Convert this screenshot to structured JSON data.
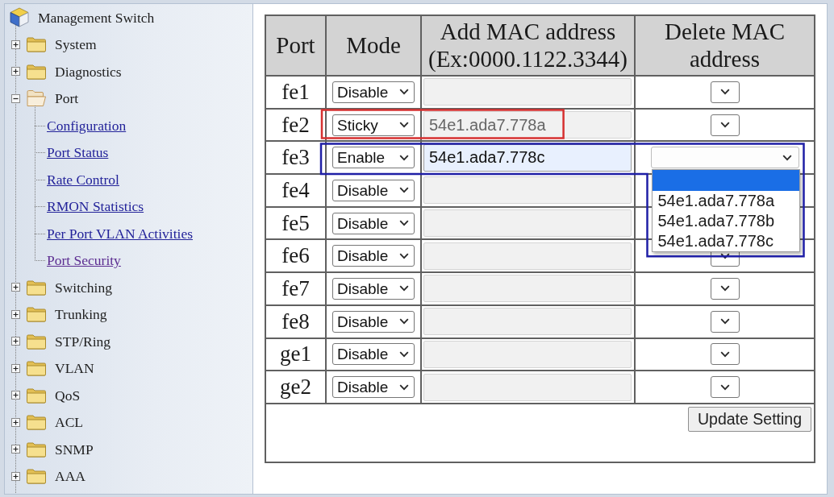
{
  "sidebar": {
    "title": "Management Switch",
    "items": [
      {
        "label": "System",
        "expanded": false
      },
      {
        "label": "Diagnostics",
        "expanded": false
      },
      {
        "label": "Port",
        "expanded": true,
        "children": [
          {
            "label": "Configuration",
            "visited": false
          },
          {
            "label": "Port Status",
            "visited": false
          },
          {
            "label": "Rate Control",
            "visited": false
          },
          {
            "label": "RMON Statistics",
            "visited": false
          },
          {
            "label": "Per Port VLAN Activities",
            "visited": false
          },
          {
            "label": "Port Security",
            "visited": true
          }
        ]
      },
      {
        "label": "Switching",
        "expanded": false
      },
      {
        "label": "Trunking",
        "expanded": false
      },
      {
        "label": "STP/Ring",
        "expanded": false
      },
      {
        "label": "VLAN",
        "expanded": false
      },
      {
        "label": "QoS",
        "expanded": false
      },
      {
        "label": "ACL",
        "expanded": false
      },
      {
        "label": "SNMP",
        "expanded": false
      },
      {
        "label": "AAA",
        "expanded": false
      }
    ]
  },
  "table": {
    "columns": [
      "Port",
      "Mode",
      "Add MAC address (Ex:0000.1122.3344)",
      "Delete MAC address"
    ],
    "rows": [
      {
        "port": "fe1",
        "mode": "Disable",
        "mac": {
          "disabled": true
        },
        "delete_mac": {
          "expanded": false
        }
      },
      {
        "port": "fe2",
        "mode": "Sticky",
        "mac": {
          "value": "54e1.ada7.778a",
          "disabled": true
        },
        "delete_mac": {
          "expanded": false
        },
        "outline": {
          "color": "#d63030",
          "kind": "fields"
        }
      },
      {
        "port": "fe3",
        "mode": "Enable",
        "mac": {
          "value": "54e1.ada7.778c",
          "disabled": false
        },
        "delete_mac": {
          "expanded": true,
          "options": [
            {
              "selected": true
            },
            {
              "label": "54e1.ada7.778a",
              "selected": false
            },
            {
              "label": "54e1.ada7.778b",
              "selected": false
            },
            {
              "label": "54e1.ada7.778c",
              "selected": false
            }
          ]
        },
        "outline": {
          "color": "#1f1fa6",
          "kind": "row"
        }
      },
      {
        "port": "fe4",
        "mode": "Disable",
        "mac": {
          "disabled": true
        }
      },
      {
        "port": "fe5",
        "mode": "Disable",
        "mac": {
          "disabled": true
        }
      },
      {
        "port": "fe6",
        "mode": "Disable",
        "mac": {
          "disabled": true
        },
        "delete_mac": {
          "expanded": false
        }
      },
      {
        "port": "fe7",
        "mode": "Disable",
        "mac": {
          "disabled": true
        },
        "delete_mac": {
          "expanded": false
        }
      },
      {
        "port": "fe8",
        "mode": "Disable",
        "mac": {
          "disabled": true
        },
        "delete_mac": {
          "expanded": false
        }
      },
      {
        "port": "ge1",
        "mode": "Disable",
        "mac": {
          "disabled": true
        },
        "delete_mac": {
          "expanded": false
        }
      },
      {
        "port": "ge2",
        "mode": "Disable",
        "mac": {
          "disabled": true
        },
        "delete_mac": {
          "expanded": false
        }
      }
    ],
    "button": "Update Setting"
  }
}
